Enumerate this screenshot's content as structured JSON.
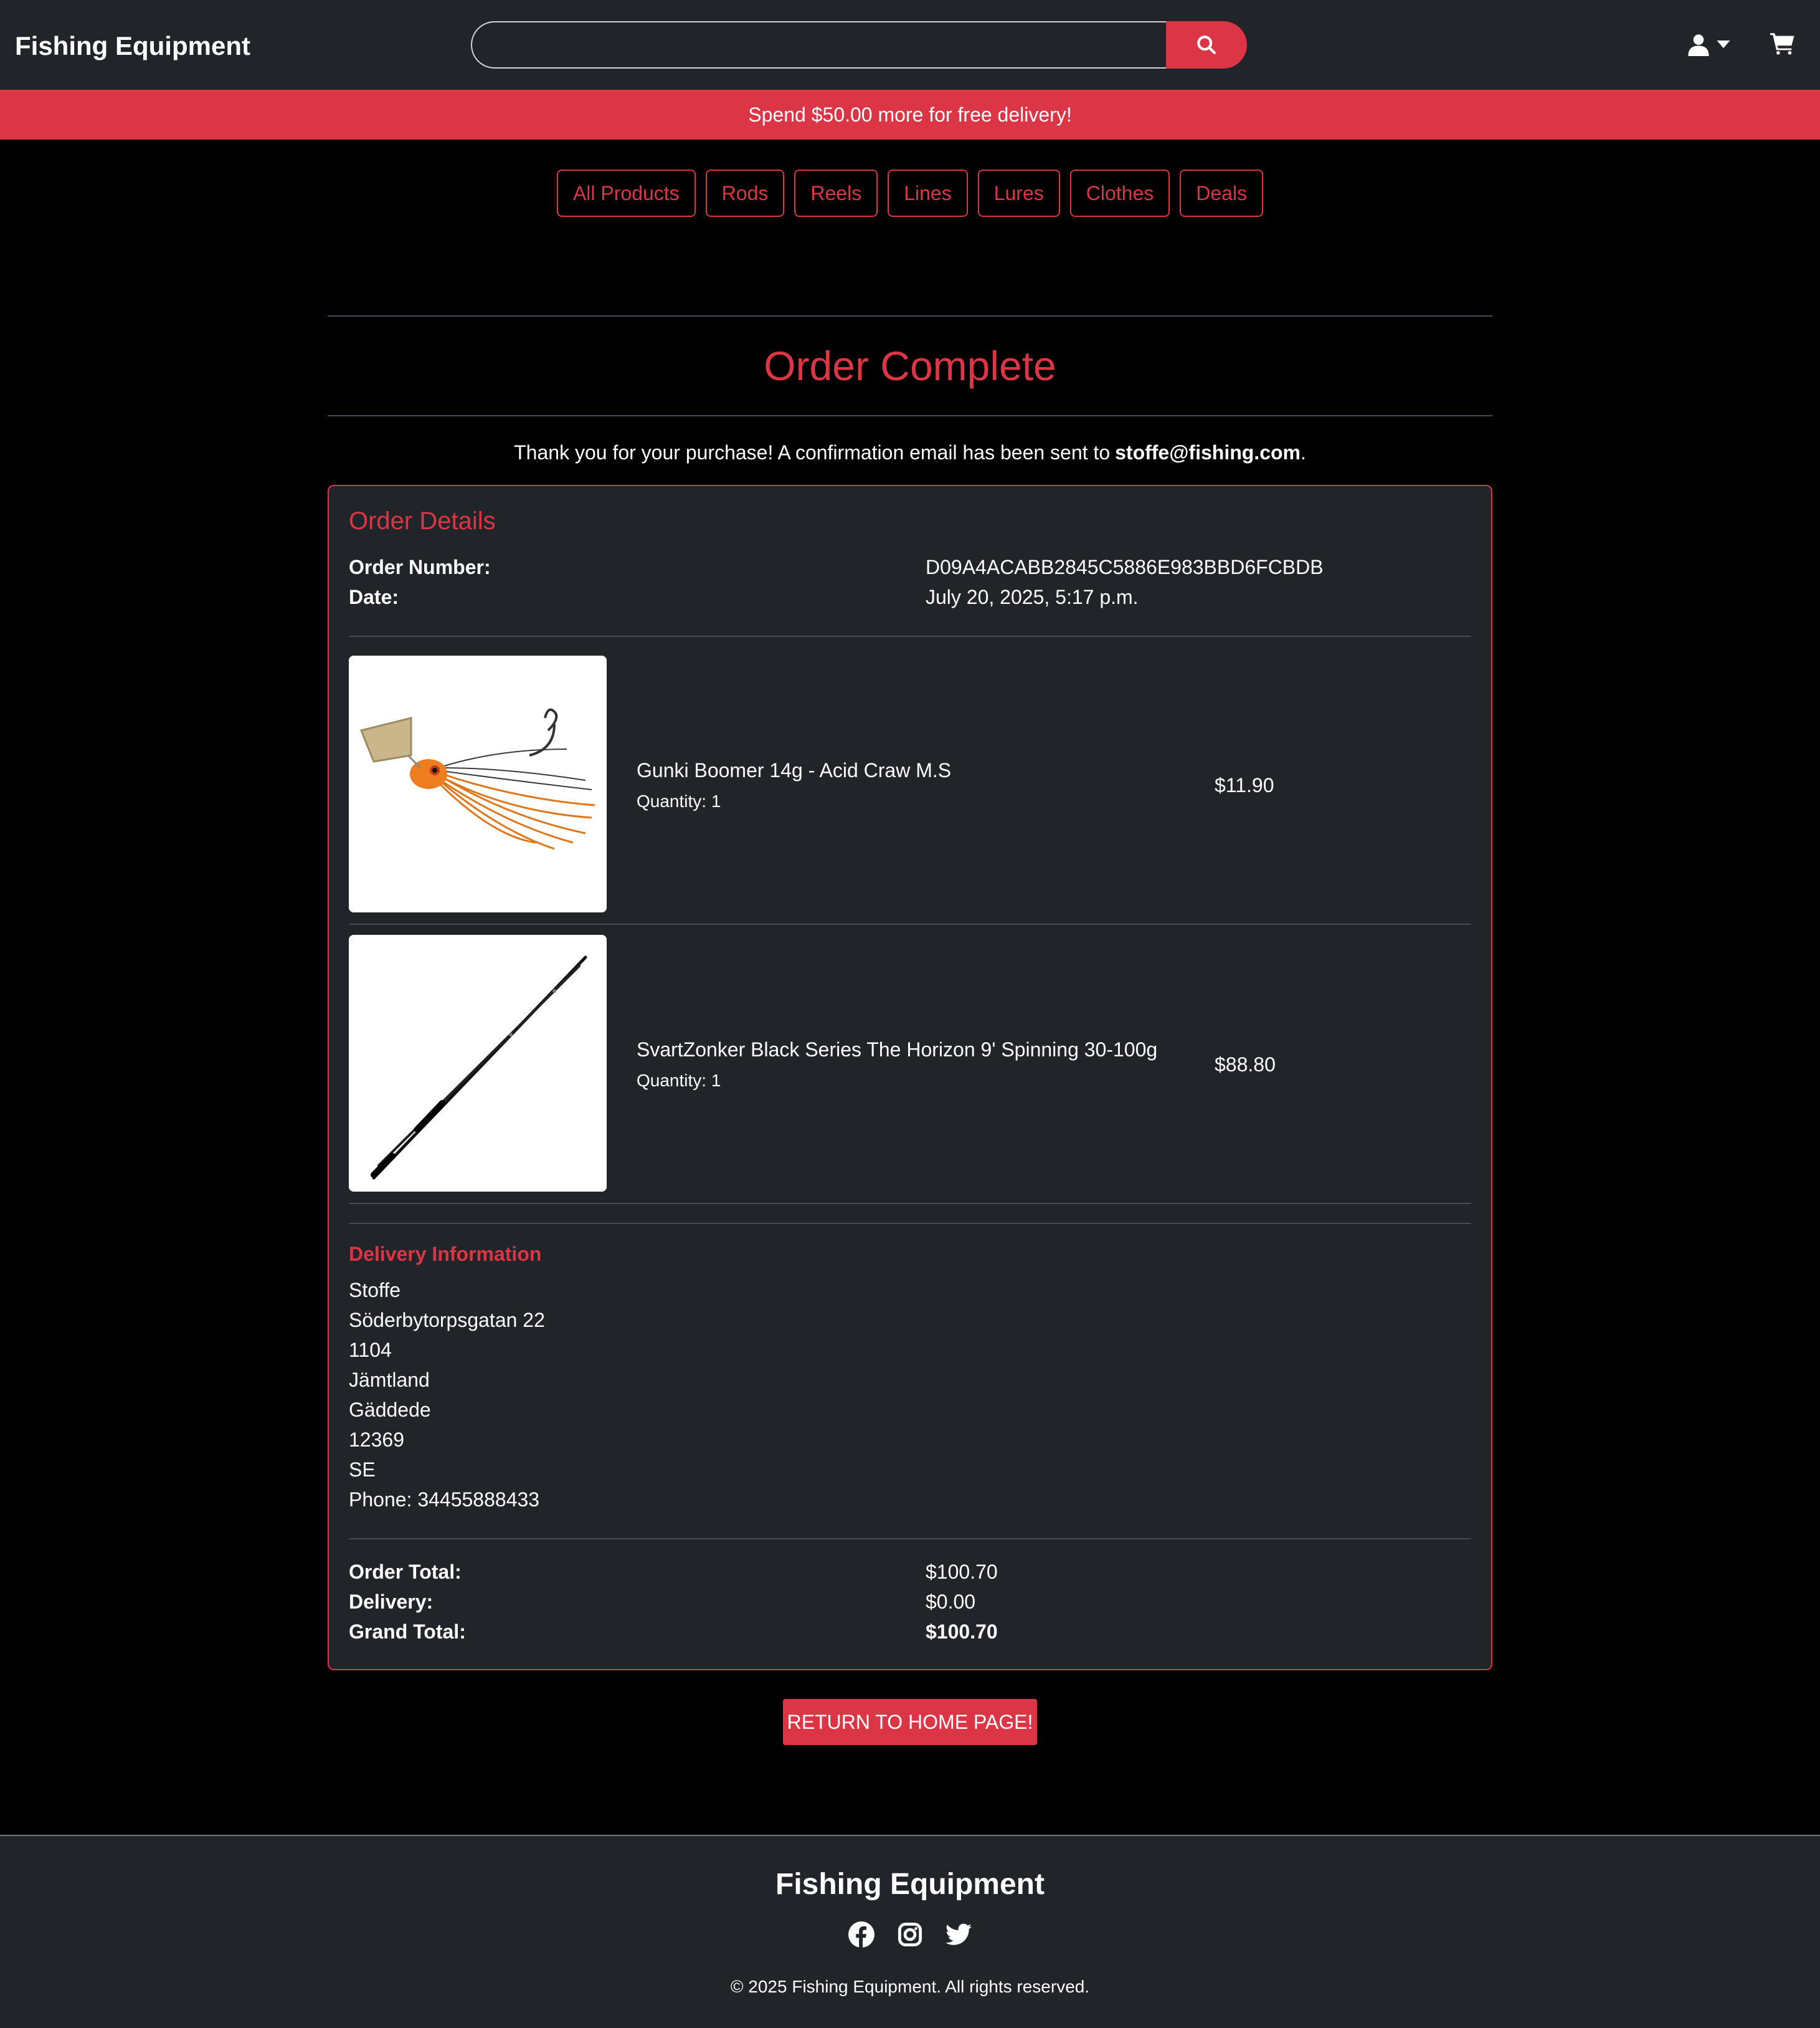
{
  "header": {
    "brand": "Fishing Equipment",
    "search_value": "",
    "icons": {
      "search": "search-icon",
      "user": "user-icon",
      "cart": "cart-icon"
    }
  },
  "promo": {
    "text": "Spend $50.00 more for free delivery!"
  },
  "categories": [
    "All Products",
    "Rods",
    "Reels",
    "Lines",
    "Lures",
    "Clothes",
    "Deals"
  ],
  "main": {
    "title": "Order Complete",
    "thanks_text": "Thank you for your purchase! A confirmation email has been sent to",
    "email": "stoffe@fishing.com",
    "thanks_end": "."
  },
  "order": {
    "section_title": "Order Details",
    "number_label": "Order Number:",
    "number_value": "D09A4ACABB2845C5886E983BBD6FCBDB",
    "date_label": "Date:",
    "date_value": "July 20, 2025, 5:17 p.m.",
    "items": [
      {
        "name": "Gunki Boomer 14g - Acid Craw M.S",
        "quantity": "Quantity: 1",
        "price": "$11.90",
        "image": "lure-image"
      },
      {
        "name": "SvartZonker Black Series The Horizon 9' Spinning 30-100g",
        "quantity": "Quantity: 1",
        "price": "$88.80",
        "image": "rod-image"
      }
    ]
  },
  "delivery": {
    "title": "Delivery Information",
    "lines": [
      "Stoffe",
      "Söderbytorpsgatan 22",
      "1104",
      "Jämtland",
      "Gäddede",
      "12369",
      "SE",
      "Phone: 34455888433"
    ]
  },
  "totals": {
    "order_total_label": "Order Total:",
    "order_total_value": "$100.70",
    "delivery_label": "Delivery:",
    "delivery_value": "$0.00",
    "grand_total_label": "Grand Total:",
    "grand_total_value": "$100.70"
  },
  "return_button": "RETURN TO HOME PAGE!",
  "footer": {
    "brand": "Fishing Equipment",
    "socials": [
      "facebook-icon",
      "instagram-icon",
      "twitter-icon"
    ],
    "copyright": "© 2025 Fishing Equipment. All rights reserved."
  },
  "colors": {
    "accent": "#dc3545",
    "panel": "#212529",
    "background": "#000000"
  }
}
